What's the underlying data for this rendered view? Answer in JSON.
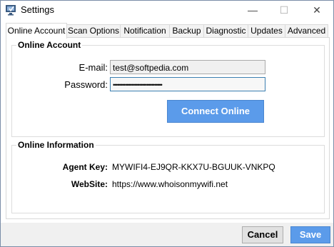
{
  "window": {
    "title": "Settings"
  },
  "titlebar": {
    "minimize": "—",
    "maximize": "☐",
    "close": "✕"
  },
  "tabs": [
    {
      "label": "Online Account",
      "active": true
    },
    {
      "label": "Scan Options"
    },
    {
      "label": "Notification"
    },
    {
      "label": "Backup"
    },
    {
      "label": "Diagnostic"
    },
    {
      "label": "Updates"
    },
    {
      "label": "Advanced"
    }
  ],
  "online_account": {
    "title": "Online Account",
    "email_label": "E-mail:",
    "email_value": "test@softpedia.com",
    "password_label": "Password:",
    "password_value": "••••••••••••••••••••••••••••••••",
    "connect_button": "Connect Online"
  },
  "online_information": {
    "title": "Online Information",
    "agent_key_label": "Agent Key:",
    "agent_key_value": "MYWIFI4-EJ9QR-KKX7U-BGUUK-VNKPQ",
    "website_label": "WebSite:",
    "website_value": "https://www.whoisonmywifi.net"
  },
  "footer": {
    "cancel": "Cancel",
    "save": "Save"
  },
  "colors": {
    "accent": "#5b9bea",
    "focus_border": "#3c7fb1"
  }
}
